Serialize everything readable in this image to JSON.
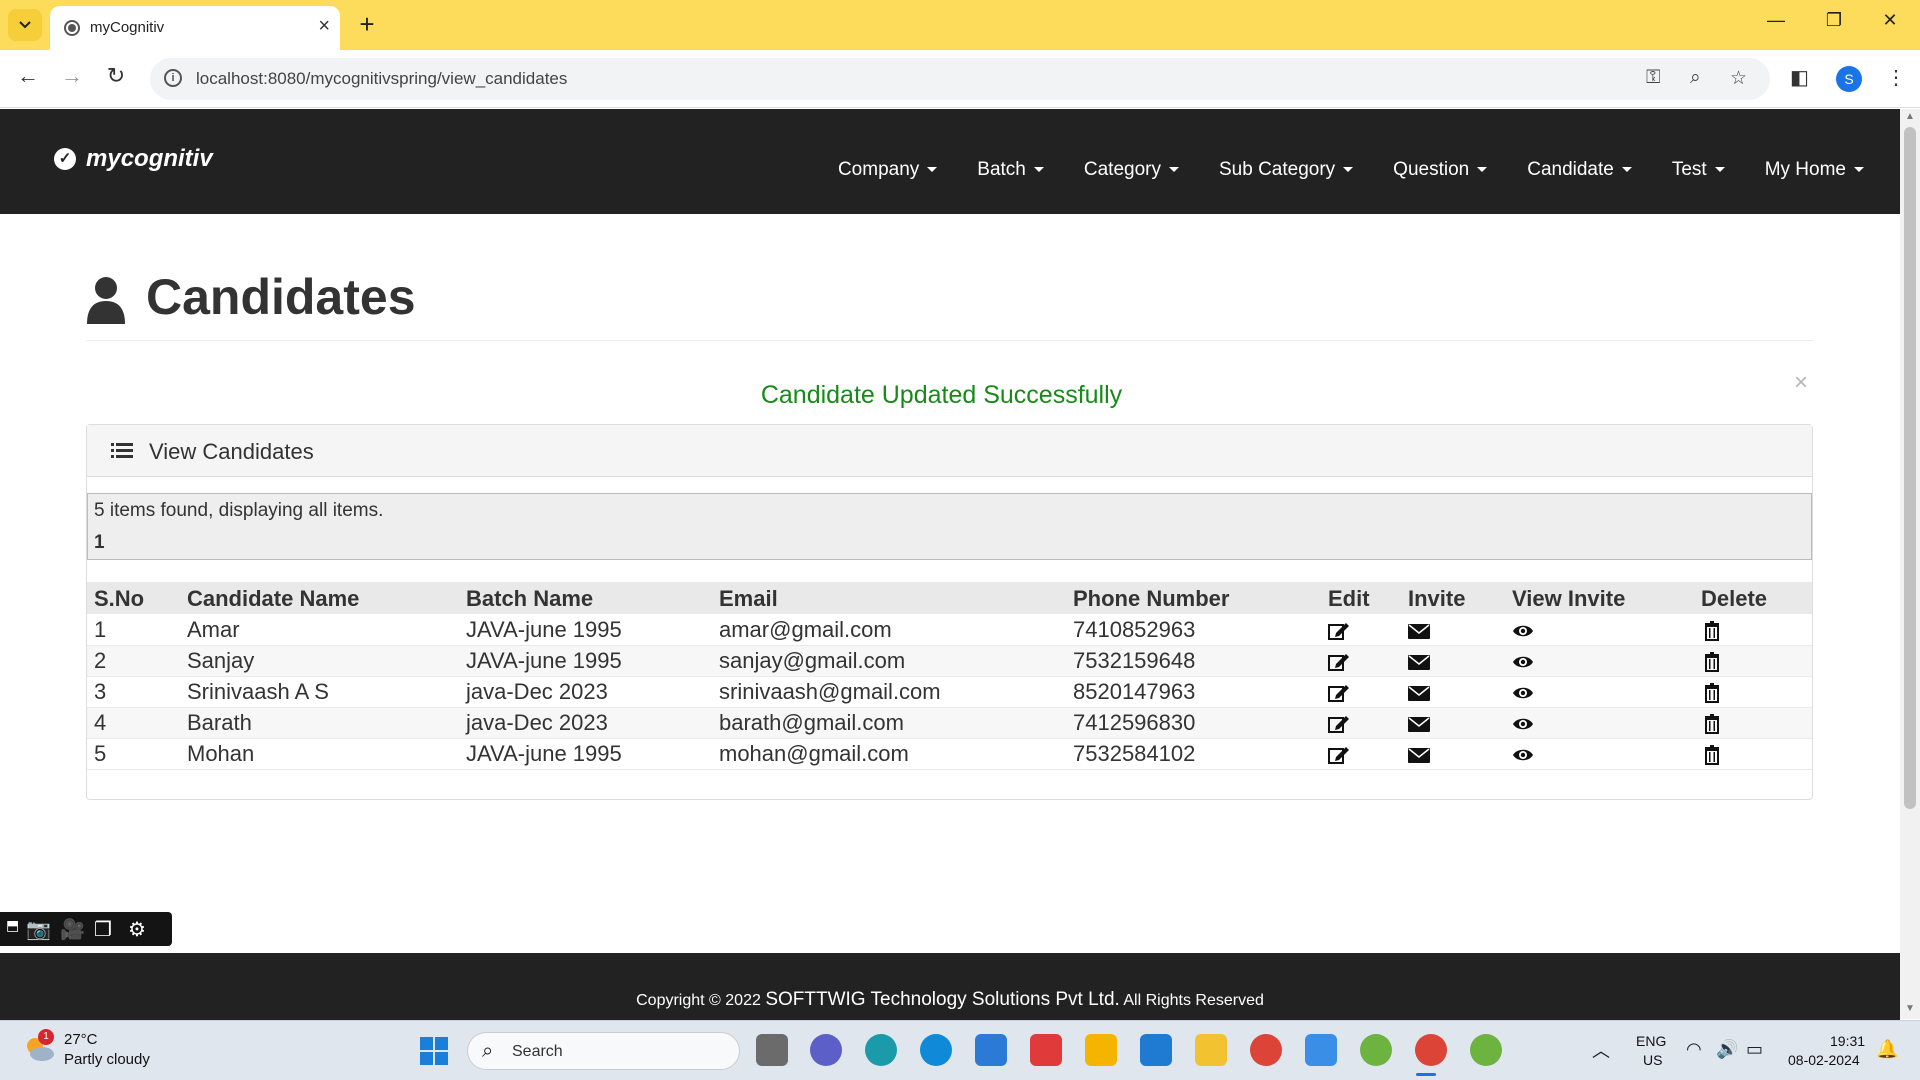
{
  "browser": {
    "tab_title": "myCognitiv",
    "url": "localhost:8080/mycognitivspring/view_candidates",
    "profile_initial": "S"
  },
  "navbar": {
    "brand": "mycognitiv",
    "menu": [
      {
        "label": "Company"
      },
      {
        "label": "Batch"
      },
      {
        "label": "Category"
      },
      {
        "label": "Sub Category"
      },
      {
        "label": "Question"
      },
      {
        "label": "Candidate"
      },
      {
        "label": "Test"
      },
      {
        "label": "My Home"
      }
    ]
  },
  "page": {
    "title": "Candidates",
    "alert": "Candidate Updated Successfully",
    "alert_close": "×",
    "panel_title": "View Candidates",
    "items_found": "5 items found, displaying all items.",
    "current_page": "1"
  },
  "table": {
    "headers": [
      "S.No",
      "Candidate Name",
      "Batch Name",
      "Email",
      "Phone Number",
      "Edit",
      "Invite",
      "View Invite",
      "Delete"
    ],
    "rows": [
      {
        "sno": "1",
        "name": "Amar",
        "batch": "JAVA-june 1995",
        "email": "amar@gmail.com",
        "phone": "7410852963"
      },
      {
        "sno": "2",
        "name": "Sanjay",
        "batch": "JAVA-june 1995",
        "email": "sanjay@gmail.com",
        "phone": "7532159648"
      },
      {
        "sno": "3",
        "name": "Srinivaash A S",
        "batch": "java-Dec 2023",
        "email": "srinivaash@gmail.com",
        "phone": "8520147963"
      },
      {
        "sno": "4",
        "name": "Barath",
        "batch": "java-Dec 2023",
        "email": "barath@gmail.com",
        "phone": "7412596830"
      },
      {
        "sno": "5",
        "name": "Mohan",
        "batch": "JAVA-june 1995",
        "email": "mohan@gmail.com",
        "phone": "7532584102"
      }
    ],
    "row_icons": [
      "edit-icon",
      "envelope-icon",
      "eye-icon",
      "trash-icon"
    ]
  },
  "footer": {
    "prefix": "Copyright © 2022",
    "company": "SOFTTWIG Technology Solutions Pvt Ltd.",
    "suffix": "All Rights Reserved"
  },
  "taskbar": {
    "weather_temp": "27°C",
    "weather_desc": "Partly cloudy",
    "weather_badge": "1",
    "search_placeholder": "Search",
    "lang_line1": "ENG",
    "lang_line2": "US",
    "time": "19:31",
    "date": "08-02-2024"
  },
  "colors": {
    "navbar": "#222222",
    "alert_text": "#188a18",
    "tabbar": "#fddc5c"
  }
}
